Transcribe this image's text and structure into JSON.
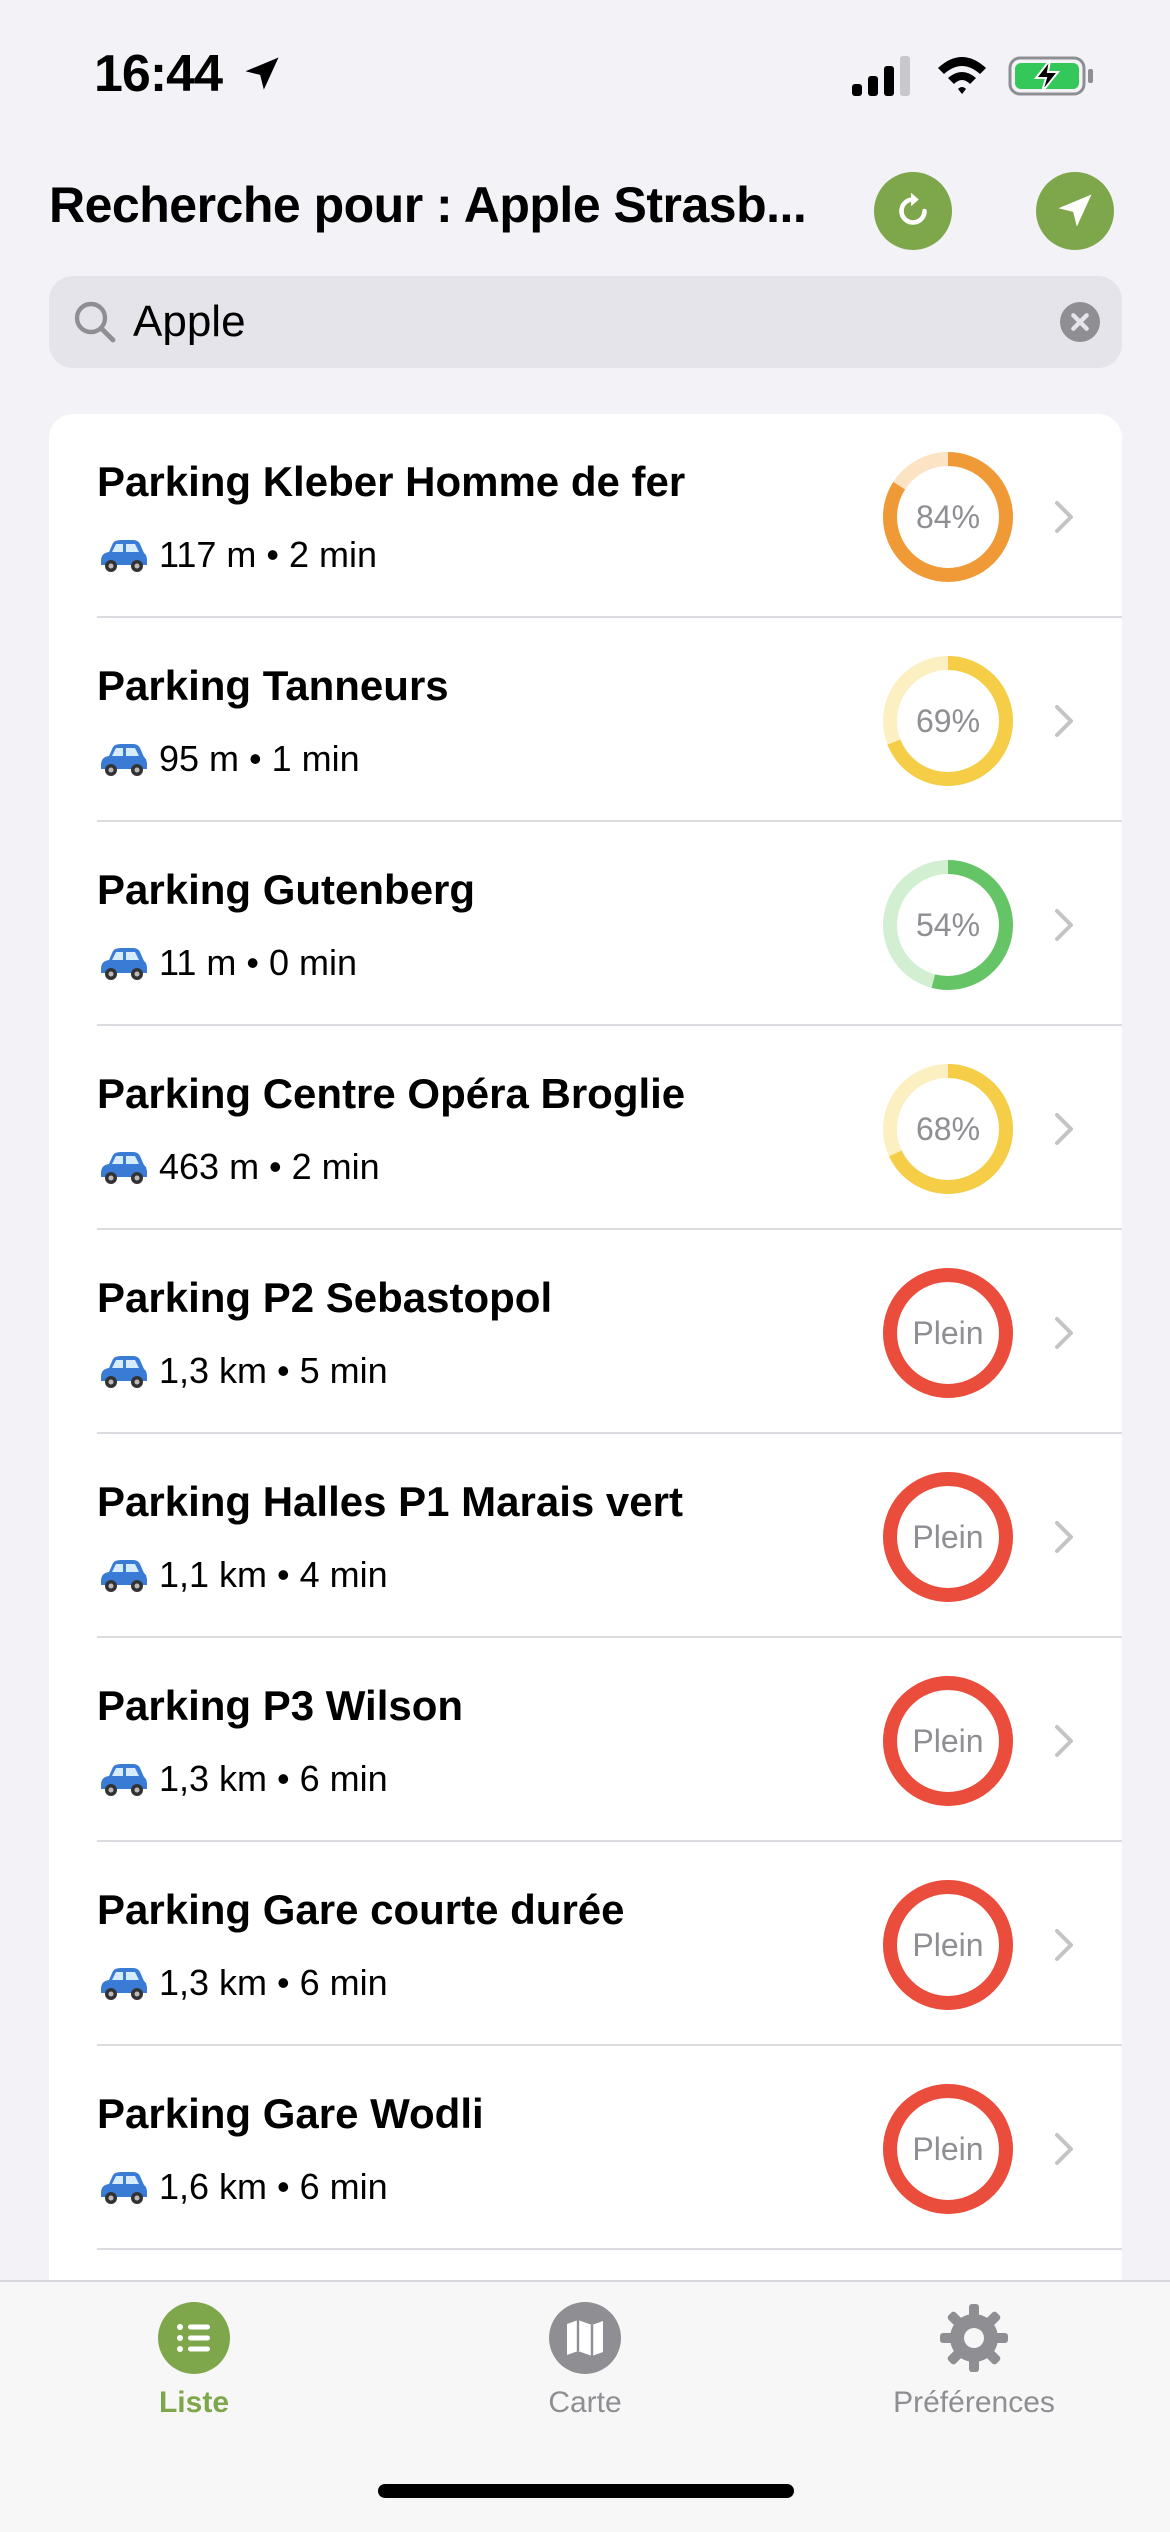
{
  "status_bar": {
    "time": "16:44",
    "icons": [
      "location-arrow-icon",
      "signal-icon",
      "wifi-icon",
      "battery-charging-icon"
    ]
  },
  "header": {
    "title": "Recherche pour : Apple Strasb...",
    "refresh_icon": "refresh-icon",
    "locate_icon": "location-arrow-icon",
    "accent_color": "#7ea64b"
  },
  "search": {
    "value": "Apple",
    "placeholder": ""
  },
  "parkings": [
    {
      "name": "Parking Kleber Homme de fer",
      "info": "117 m • 2 min",
      "status": "84%",
      "occupancy": 0.84,
      "color": "#f09a37",
      "track": "#fbe3c4"
    },
    {
      "name": "Parking Tanneurs",
      "info": "95 m • 1 min",
      "status": "69%",
      "occupancy": 0.69,
      "color": "#f5cd47",
      "track": "#fcefc1"
    },
    {
      "name": "Parking Gutenberg",
      "info": "11 m • 0 min",
      "status": "54%",
      "occupancy": 0.54,
      "color": "#65c466",
      "track": "#d2efd1"
    },
    {
      "name": "Parking Centre Opéra Broglie",
      "info": "463 m • 2 min",
      "status": "68%",
      "occupancy": 0.68,
      "color": "#f5cd47",
      "track": "#fcefc1"
    },
    {
      "name": "Parking P2 Sebastopol",
      "info": "1,3 km • 5 min",
      "status": "Plein",
      "occupancy": 1.0,
      "color": "#eb4d3d",
      "track": "#f9c9c4"
    },
    {
      "name": "Parking Halles P1 Marais vert",
      "info": "1,1 km • 4 min",
      "status": "Plein",
      "occupancy": 1.0,
      "color": "#eb4d3d",
      "track": "#f9c9c4"
    },
    {
      "name": "Parking P3 Wilson",
      "info": "1,3 km • 6 min",
      "status": "Plein",
      "occupancy": 1.0,
      "color": "#eb4d3d",
      "track": "#f9c9c4"
    },
    {
      "name": "Parking Gare courte durée",
      "info": "1,3 km • 6 min",
      "status": "Plein",
      "occupancy": 1.0,
      "color": "#eb4d3d",
      "track": "#f9c9c4"
    },
    {
      "name": "Parking Gare Wodli",
      "info": "1,6 km • 6 min",
      "status": "Plein",
      "occupancy": 1.0,
      "color": "#eb4d3d",
      "track": "#f9c9c4"
    }
  ],
  "tab_bar": {
    "tabs": [
      {
        "label": "Liste",
        "icon": "list-icon",
        "active": true
      },
      {
        "label": "Carte",
        "icon": "map-icon",
        "active": false
      },
      {
        "label": "Préférences",
        "icon": "gear-icon",
        "active": false
      }
    ]
  }
}
